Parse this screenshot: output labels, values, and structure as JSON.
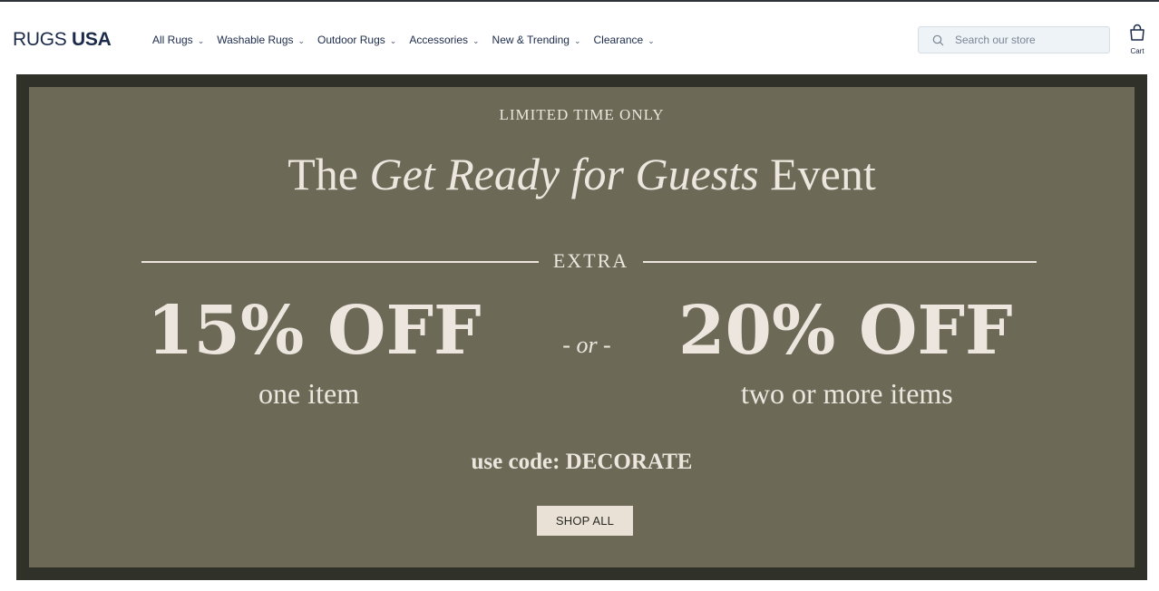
{
  "header": {
    "logo": {
      "part_a": "RUGS ",
      "part_b": "USA"
    },
    "nav": [
      {
        "label": "All Rugs"
      },
      {
        "label": "Washable Rugs"
      },
      {
        "label": "Outdoor Rugs"
      },
      {
        "label": "Accessories"
      },
      {
        "label": "New & Trending"
      },
      {
        "label": "Clearance"
      }
    ],
    "search": {
      "placeholder": "Search our store",
      "value": ""
    },
    "cart": {
      "label": "Cart"
    }
  },
  "banner": {
    "eyebrow": "LIMITED TIME ONLY",
    "title": {
      "part_a": "The ",
      "part_b": "Get Ready for Guests",
      "part_c": " Event"
    },
    "extra": "EXTRA",
    "offer_left": {
      "amount": "15% OFF",
      "detail": "one item"
    },
    "or": "- or -",
    "offer_right": {
      "amount": "20% OFF",
      "detail": "two or more items"
    },
    "code": "use code: DECORATE",
    "button": "SHOP ALL"
  },
  "colors": {
    "brand_navy": "#1c2b4a",
    "banner_fill": "#6c6a56",
    "banner_frame": "#30322a",
    "banner_text": "#ece6df",
    "button_bg": "#e9e1d6"
  },
  "icons": {
    "search": "search-icon",
    "cart": "shopping-bag-icon",
    "chevron": "chevron-down-icon"
  }
}
